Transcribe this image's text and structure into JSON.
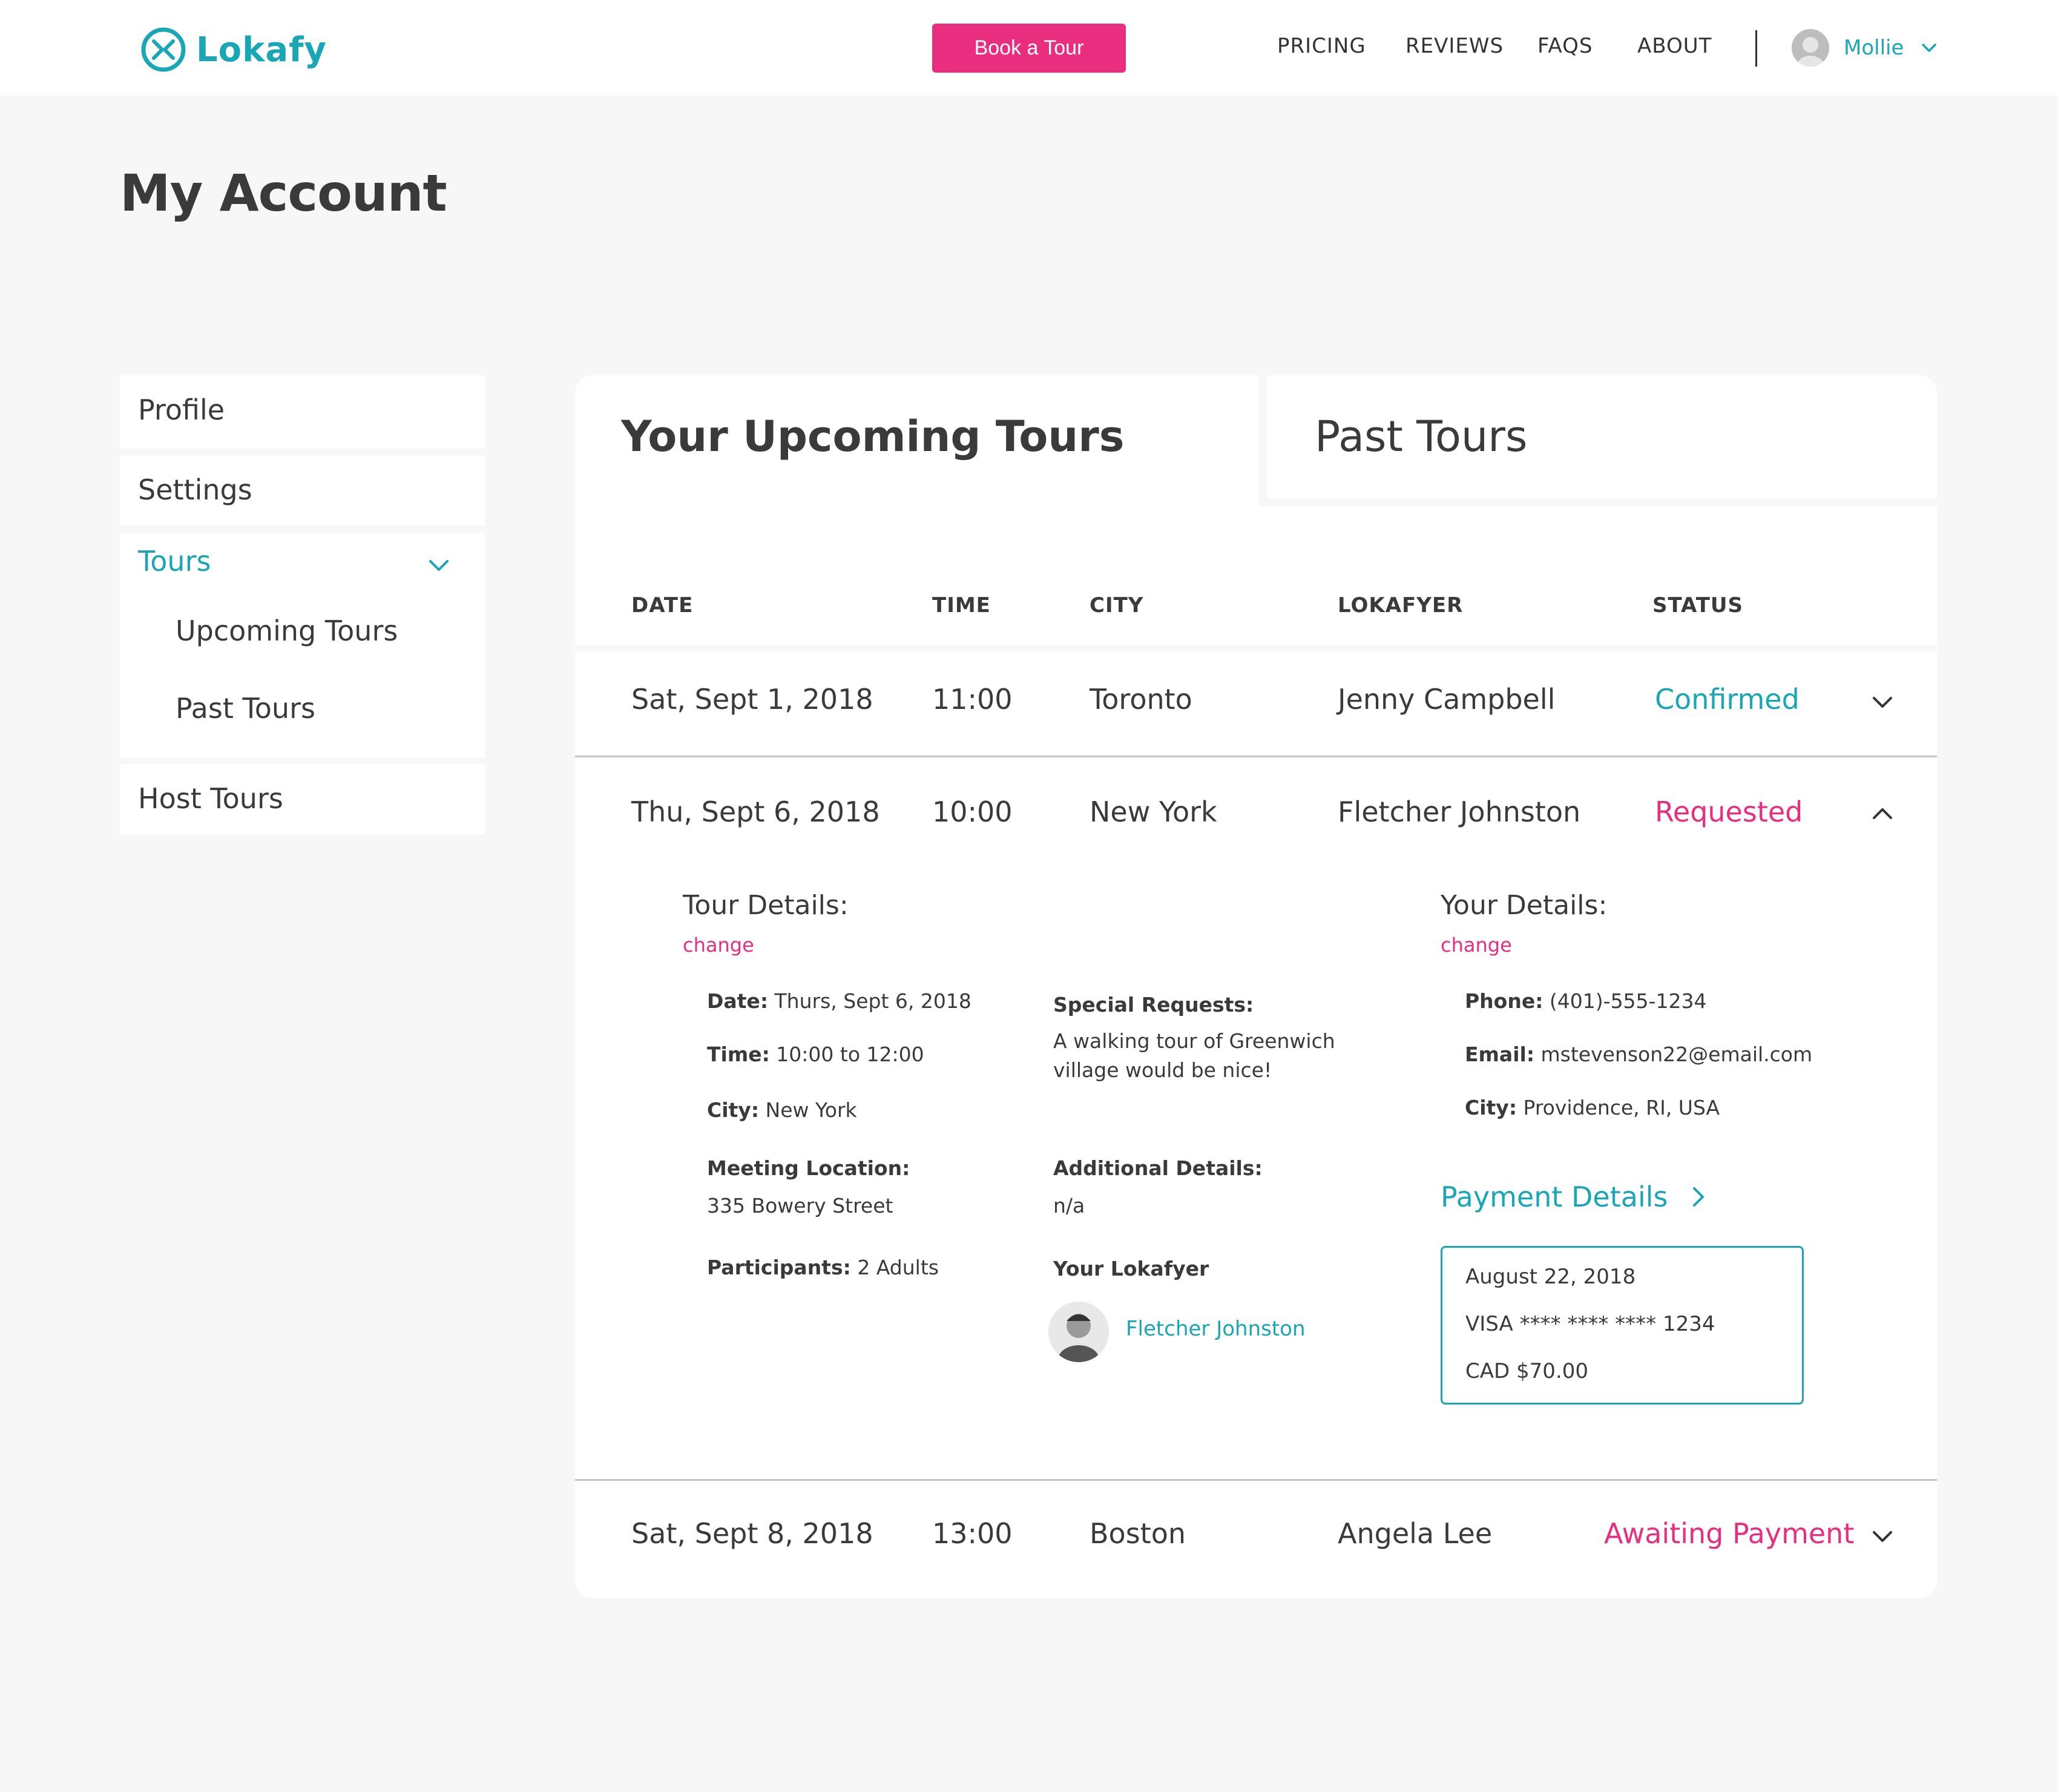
{
  "brand": {
    "name": "Lokafy",
    "color": "#19a6b5",
    "accent": "#ea2e7f"
  },
  "header": {
    "cta_label": "Book a Tour",
    "nav": [
      "PRICING",
      "REVIEWS",
      "FAQS",
      "ABOUT"
    ],
    "user_name": "Mollie"
  },
  "page_title": "My Account",
  "sidebar": {
    "profile": "Profile",
    "settings": "Settings",
    "tours": "Tours",
    "tours_sub": [
      "Upcoming Tours",
      "Past Tours"
    ],
    "host_tours": "Host Tours"
  },
  "tabs": {
    "upcoming": "Your Upcoming Tours",
    "past": "Past Tours"
  },
  "table": {
    "headers": [
      "DATE",
      "TIME",
      "CITY",
      "LOKAFYER",
      "STATUS"
    ],
    "rows": [
      {
        "date": "Sat, Sept 1, 2018",
        "time": "11:00",
        "city": "Toronto",
        "lokafyer": "Jenny Campbell",
        "status": "Confirmed"
      },
      {
        "date": "Thu, Sept 6, 2018",
        "time": "10:00",
        "city": "New York",
        "lokafyer": "Fletcher Johnston",
        "status": "Requested"
      },
      {
        "date": "Sat, Sept 8, 2018",
        "time": "13:00",
        "city": "Boston",
        "lokafyer": "Angela Lee",
        "status": "Awaiting Payment"
      }
    ]
  },
  "tour_details": {
    "title": "Tour Details:",
    "change": "change",
    "date_label": "Date:",
    "date": "Thurs, Sept 6, 2018",
    "time_label": "Time:",
    "time": "10:00 to 12:00",
    "city_label": "City:",
    "city": "New York",
    "meeting_label": "Meeting Location:",
    "meeting": "335 Bowery Street",
    "participants_label": "Participants:",
    "participants": "2 Adults",
    "special_label": "Special Requests:",
    "special_line1": "A walking tour of Greenwich",
    "special_line2": "village would be nice!",
    "additional_label": "Additional Details:",
    "additional": "n/a",
    "lokafyer_label": "Your Lokafyer",
    "lokafyer_name": "Fletcher Johnston"
  },
  "your_details": {
    "title": "Your Details:",
    "change": "change",
    "phone_label": "Phone:",
    "phone": "(401)-555-1234",
    "email_label": "Email:",
    "email": "mstevenson22@email.com",
    "city_label": "City:",
    "city": "Providence, RI, USA"
  },
  "payment": {
    "title": "Payment Details",
    "date": "August 22, 2018",
    "card": "VISA  **** **** **** 1234",
    "amount": "CAD $70.00"
  }
}
